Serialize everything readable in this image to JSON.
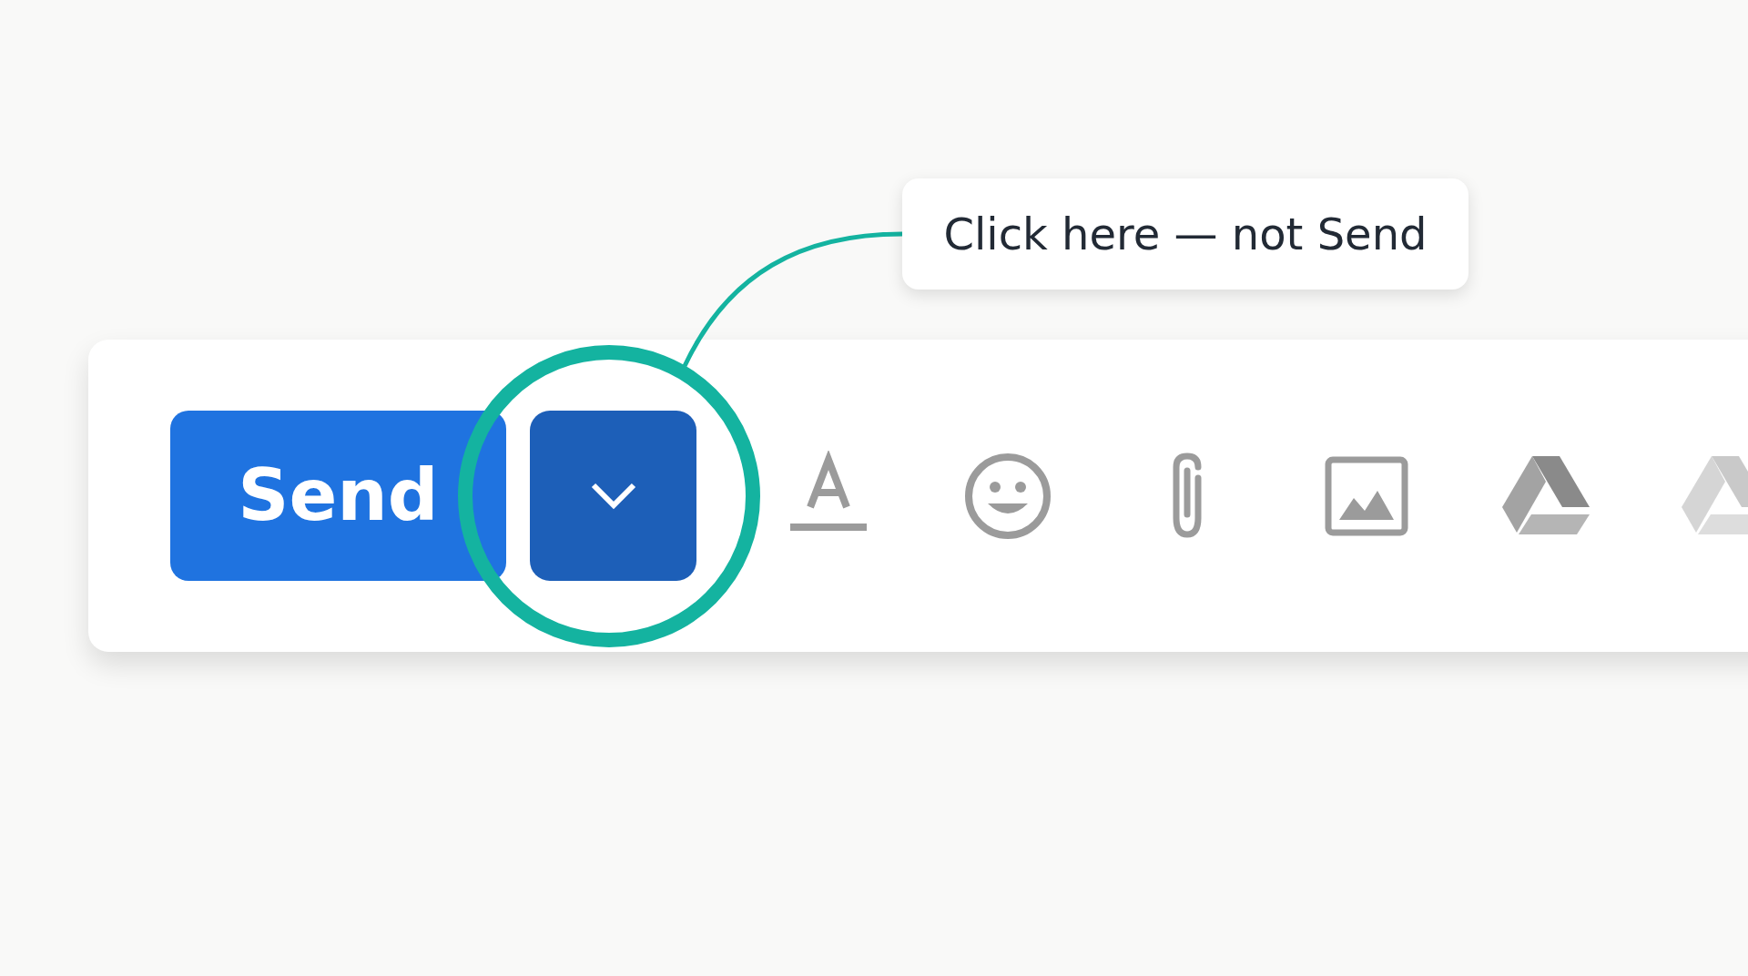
{
  "callout": {
    "text": "Click here — not Send"
  },
  "toolbar": {
    "send_button": {
      "label": "Send"
    },
    "more_send_options": {
      "highlighted": true
    },
    "tools": [
      {
        "kind": "text-format"
      },
      {
        "kind": "emoji"
      },
      {
        "kind": "attach"
      },
      {
        "kind": "photo"
      },
      {
        "kind": "drive"
      },
      {
        "kind": "drive-faded"
      }
    ]
  }
}
